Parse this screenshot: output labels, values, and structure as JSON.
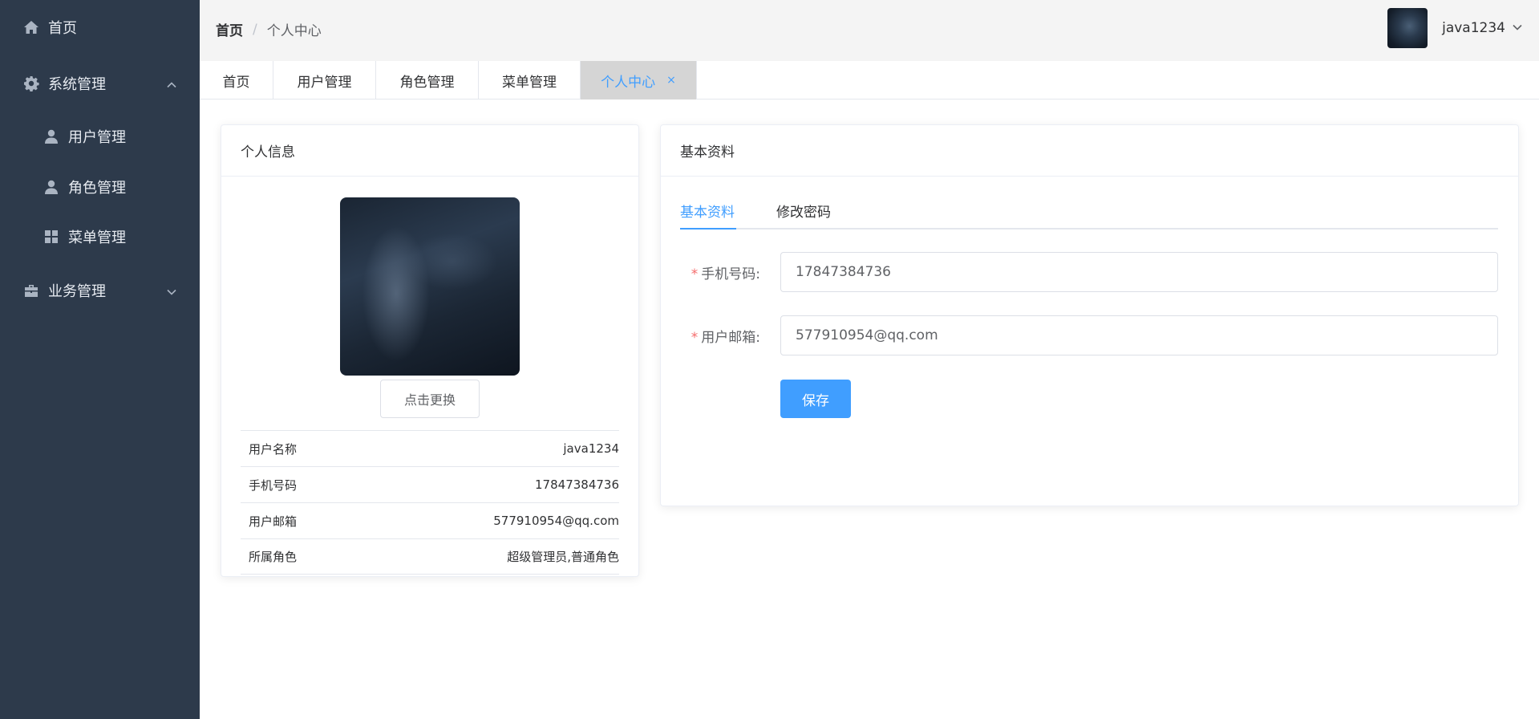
{
  "sidebar": {
    "items": [
      {
        "label": "首页",
        "icon": "home-icon"
      },
      {
        "label": "系统管理",
        "icon": "gear-icon",
        "expanded": true
      },
      {
        "label": "用户管理",
        "icon": "user-icon"
      },
      {
        "label": "角色管理",
        "icon": "user-icon"
      },
      {
        "label": "菜单管理",
        "icon": "grid-icon"
      },
      {
        "label": "业务管理",
        "icon": "briefcase-icon",
        "expanded": false
      }
    ]
  },
  "header": {
    "breadcrumb": {
      "home": "首页",
      "separator": "/",
      "current": "个人中心"
    },
    "username": "java1234"
  },
  "tabs": [
    {
      "label": "首页"
    },
    {
      "label": "用户管理"
    },
    {
      "label": "角色管理"
    },
    {
      "label": "菜单管理"
    },
    {
      "label": "个人中心",
      "active": true,
      "close": "×"
    }
  ],
  "profile_card": {
    "title": "个人信息",
    "change_button": "点击更换",
    "rows": [
      {
        "label": "用户名称",
        "value": "java1234"
      },
      {
        "label": "手机号码",
        "value": "17847384736"
      },
      {
        "label": "用户邮箱",
        "value": "577910954@qq.com"
      },
      {
        "label": "所属角色",
        "value": "超级管理员,普通角色"
      }
    ]
  },
  "basic_card": {
    "title": "基本资料",
    "tabs": [
      {
        "label": "基本资料",
        "active": true
      },
      {
        "label": "修改密码"
      }
    ],
    "form": {
      "required_mark": "*",
      "phone_label": "手机号码:",
      "phone_value": "17847384736",
      "email_label": "用户邮箱:",
      "email_value": "577910954@qq.com",
      "save_label": "保存"
    }
  },
  "colors": {
    "sidebar_bg": "#2d3a4b",
    "primary": "#409eff",
    "required": "#f56c6c",
    "active_tab_bg": "#d5d5d5"
  }
}
